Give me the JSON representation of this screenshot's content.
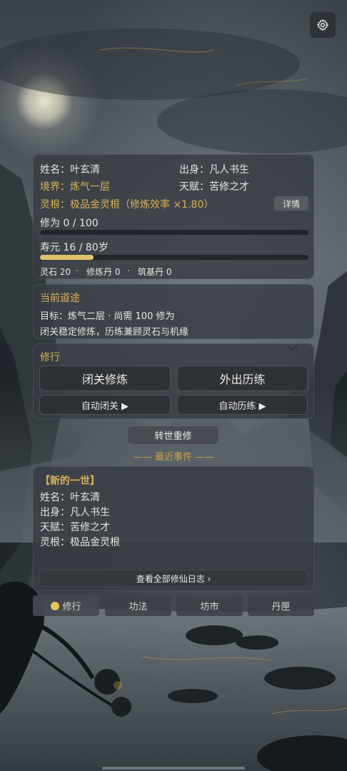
{
  "settings_icon": "gear-icon",
  "colors": {
    "accent_gold": "#d9b25a",
    "panel_bg": "#373c42",
    "bar_gold": "#e0c26a",
    "active_dot": "#e8c455"
  },
  "character": {
    "name_label": "姓名：叶玄清",
    "origin_label": "出身：凡人书生",
    "realm_label": "境界：炼气一层",
    "talent_label": "天赋：苦修之才",
    "root_label": "灵根：极品金灵根（修炼效率 ×1.80）",
    "detail_button": "详情",
    "cultivation_label": "修为 0 / 100",
    "cultivation_progress": 0,
    "lifespan_label": "寿元 16 / 80岁",
    "lifespan_progress": 0.2,
    "resources": {
      "spirit_stone": "灵石 20",
      "sep1": "·",
      "cultivation_pill": "修炼丹 0",
      "sep2": "·",
      "foundation_pill": "筑基丹 0"
    }
  },
  "path": {
    "title": "当前道途",
    "goal": "目标：炼气二层 · 尚需 100 修为",
    "advice": "闭关稳定修炼，历练兼顾灵石与机缘"
  },
  "actions": {
    "title": "修行",
    "seclusion": "闭关修炼",
    "travel": "外出历练",
    "auto_seclusion": "自动闭关 ▶",
    "auto_travel": "自动历练 ▶"
  },
  "reincarnate_button": "转世重修",
  "events": {
    "divider": "—— 最近事件 ——",
    "heading": "【新的一世】",
    "lines": [
      "姓名：叶玄清",
      "出身：凡人书生",
      "天赋：苦修之才",
      "灵根：极品金灵根"
    ],
    "view_all": "查看全部修仙日志 ›"
  },
  "tabs": [
    {
      "label": "修行",
      "active": true
    },
    {
      "label": "功法",
      "active": false
    },
    {
      "label": "坊市",
      "active": false
    },
    {
      "label": "丹匣",
      "active": false
    }
  ]
}
